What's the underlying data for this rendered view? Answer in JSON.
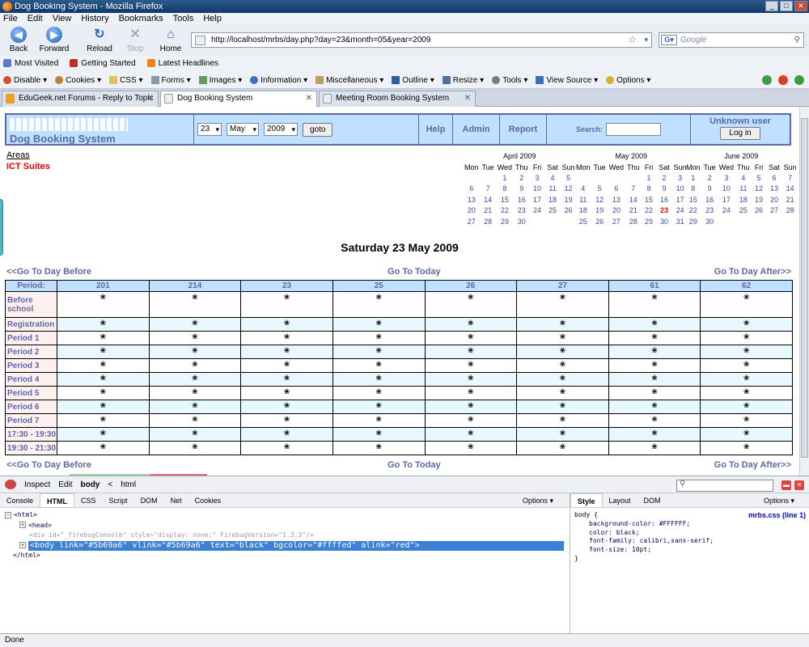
{
  "window": {
    "title": "Dog Booking System - Mozilla Firefox",
    "min": "_",
    "max": "□",
    "close": "✕"
  },
  "menu": [
    "File",
    "Edit",
    "View",
    "History",
    "Bookmarks",
    "Tools",
    "Help"
  ],
  "nav": {
    "back": "Back",
    "forward": "Forward",
    "reload": "Reload",
    "stop": "Stop",
    "home": "Home"
  },
  "url": "http://localhost/mrbs/day.php?day=23&month=05&year=2009",
  "search_placeholder": "Google",
  "bookmarks": [
    "Most Visited",
    "Getting Started",
    "Latest Headlines"
  ],
  "devtools": [
    "Disable",
    "Cookies",
    "CSS",
    "Forms",
    "Images",
    "Information",
    "Miscellaneous",
    "Outline",
    "Resize",
    "Tools",
    "View Source",
    "Options"
  ],
  "tabs": [
    "EduGeek.net Forums - Reply to Topic",
    "Dog Booking System",
    "Meeting Room Booking System"
  ],
  "page": {
    "system_name": "Dog Booking System",
    "day_sel": "23",
    "month_sel": "May",
    "year_sel": "2009",
    "goto": "goto",
    "help": "Help",
    "admin": "Admin",
    "report": "Report",
    "search_label": "Search:",
    "user": "Unknown user",
    "login": "Log in",
    "areas": "Areas",
    "area_current": "ICT Suites",
    "title": "Saturday 23 May 2009",
    "prev": "<<Go To Day Before",
    "today": "Go To Today",
    "next": "Go To Day After>>",
    "period_header": "Period:",
    "rooms": [
      "201",
      "214",
      "23",
      "25",
      "26",
      "27",
      "61",
      "62"
    ],
    "periods": [
      "Before school",
      "Registration",
      "Period 1",
      "Period 2",
      "Period 3",
      "Period 4",
      "Period 5",
      "Period 6",
      "Period 7",
      "17:30 - 19:30",
      "19:30 - 21:30"
    ],
    "slot_mark": "❀"
  },
  "calendars": [
    {
      "title": "April 2009",
      "rows": [
        [
          "",
          "",
          "1",
          "2",
          "3",
          "4",
          "5"
        ],
        [
          "6",
          "7",
          "8",
          "9",
          "10",
          "11",
          "12"
        ],
        [
          "13",
          "14",
          "15",
          "16",
          "17",
          "18",
          "19"
        ],
        [
          "20",
          "21",
          "22",
          "23",
          "24",
          "25",
          "26"
        ],
        [
          "27",
          "28",
          "29",
          "30",
          "",
          "",
          ""
        ]
      ]
    },
    {
      "title": "May 2009",
      "rows": [
        [
          "",
          "",
          "",
          "",
          "1",
          "2",
          "3"
        ],
        [
          "4",
          "5",
          "6",
          "7",
          "8",
          "9",
          "10"
        ],
        [
          "11",
          "12",
          "13",
          "14",
          "15",
          "16",
          "17"
        ],
        [
          "18",
          "19",
          "20",
          "21",
          "22",
          "23",
          "24"
        ],
        [
          "25",
          "26",
          "27",
          "28",
          "29",
          "30",
          "31"
        ]
      ],
      "highlight": "23"
    },
    {
      "title": "June 2009",
      "rows": [
        [
          "1",
          "2",
          "3",
          "4",
          "5",
          "6",
          "7"
        ],
        [
          "8",
          "9",
          "10",
          "11",
          "12",
          "13",
          "14"
        ],
        [
          "15",
          "16",
          "17",
          "18",
          "19",
          "20",
          "21"
        ],
        [
          "22",
          "23",
          "24",
          "25",
          "26",
          "27",
          "28"
        ],
        [
          "29",
          "30",
          "",
          "",
          "",
          "",
          ""
        ]
      ]
    }
  ],
  "weekdays": [
    "Mon",
    "Tue",
    "Wed",
    "Thu",
    "Fri",
    "Sat",
    "Sun"
  ],
  "firebug": {
    "toolbar": [
      "Inspect",
      "Edit",
      "body",
      "<",
      "html"
    ],
    "tabs": [
      "Console",
      "HTML",
      "CSS",
      "Script",
      "DOM",
      "Net",
      "Cookies"
    ],
    "options": "Options ▾",
    "rtabs": [
      "Style",
      "Layout",
      "DOM"
    ],
    "html_lines": [
      "<html>",
      "<head>",
      "<div id=\"_firebugConsole\" style=\"display: none;\" FirebugVersion=\"1.3.3\"/>",
      "<body link=\"#5b69a6\" vlink=\"#5b69a6\" text=\"black\" bgcolor=\"#ffffed\" alink=\"red\">",
      "</html>"
    ],
    "style_src": "mrbs.css (line 1)",
    "style_sel": "body {",
    "style_props": [
      "background-color: #FFFFFF;",
      "color: black;",
      "font-family: calibri,sans-serif;",
      "font-size: 10pt;"
    ],
    "style_end": "}"
  },
  "status": "Done"
}
